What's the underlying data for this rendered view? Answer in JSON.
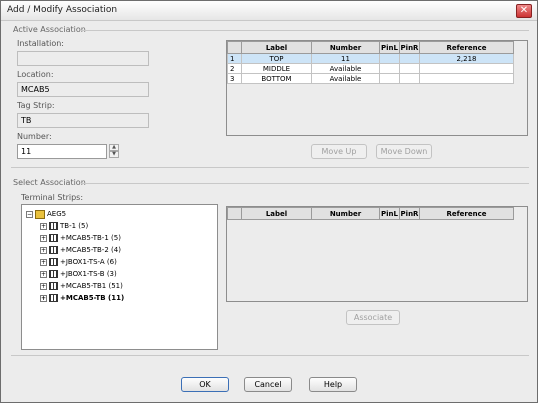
{
  "window": {
    "title": "Add / Modify Association",
    "close_glyph": "✕"
  },
  "active": {
    "group_label": "Active Association",
    "installation_label": "Installation:",
    "installation_value": "",
    "location_label": "Location:",
    "location_value": "MCAB5",
    "tagstrip_label": "Tag Strip:",
    "tagstrip_value": "TB",
    "number_label": "Number:",
    "number_value": "11",
    "columns": [
      "Label",
      "Number",
      "PinL",
      "PinR",
      "Reference"
    ],
    "rows": [
      {
        "num": "1",
        "label": "TOP",
        "number": "11",
        "pinl": "",
        "pinr": "",
        "reference": "2,218",
        "selected": true
      },
      {
        "num": "2",
        "label": "MIDDLE",
        "number": "Available",
        "pinl": "",
        "pinr": "",
        "reference": ""
      },
      {
        "num": "3",
        "label": "BOTTOM",
        "number": "Available",
        "pinl": "",
        "pinr": "",
        "reference": ""
      }
    ],
    "move_up": "Move Up",
    "move_down": "Move Down"
  },
  "select": {
    "group_label": "Select Association",
    "strips_label": "Terminal Strips:",
    "tree": [
      {
        "text": "AEG5",
        "level": 0,
        "icon": "root-icon"
      },
      {
        "text": "TB-1 (5)",
        "level": 1,
        "icon": "terminal-strip-icon"
      },
      {
        "text": "+MCAB5-TB-1 (5)",
        "level": 1,
        "icon": "terminal-strip-icon"
      },
      {
        "text": "+MCAB5-TB-2 (4)",
        "level": 1,
        "icon": "terminal-strip-icon"
      },
      {
        "text": "+JBOX1-TS-A (6)",
        "level": 1,
        "icon": "terminal-strip-icon"
      },
      {
        "text": "+JBOX1-TS-B (3)",
        "level": 1,
        "icon": "terminal-strip-icon"
      },
      {
        "text": "+MCAB5-TB1 (51)",
        "level": 1,
        "icon": "terminal-strip-icon"
      },
      {
        "text": "+MCAB5-TB (11)",
        "level": 1,
        "icon": "terminal-strip-icon",
        "bold": true
      }
    ],
    "columns": [
      "Label",
      "Number",
      "PinL",
      "PinR",
      "Reference"
    ],
    "associate": "Associate"
  },
  "footer": {
    "ok": "OK",
    "cancel": "Cancel",
    "help": "Help"
  }
}
